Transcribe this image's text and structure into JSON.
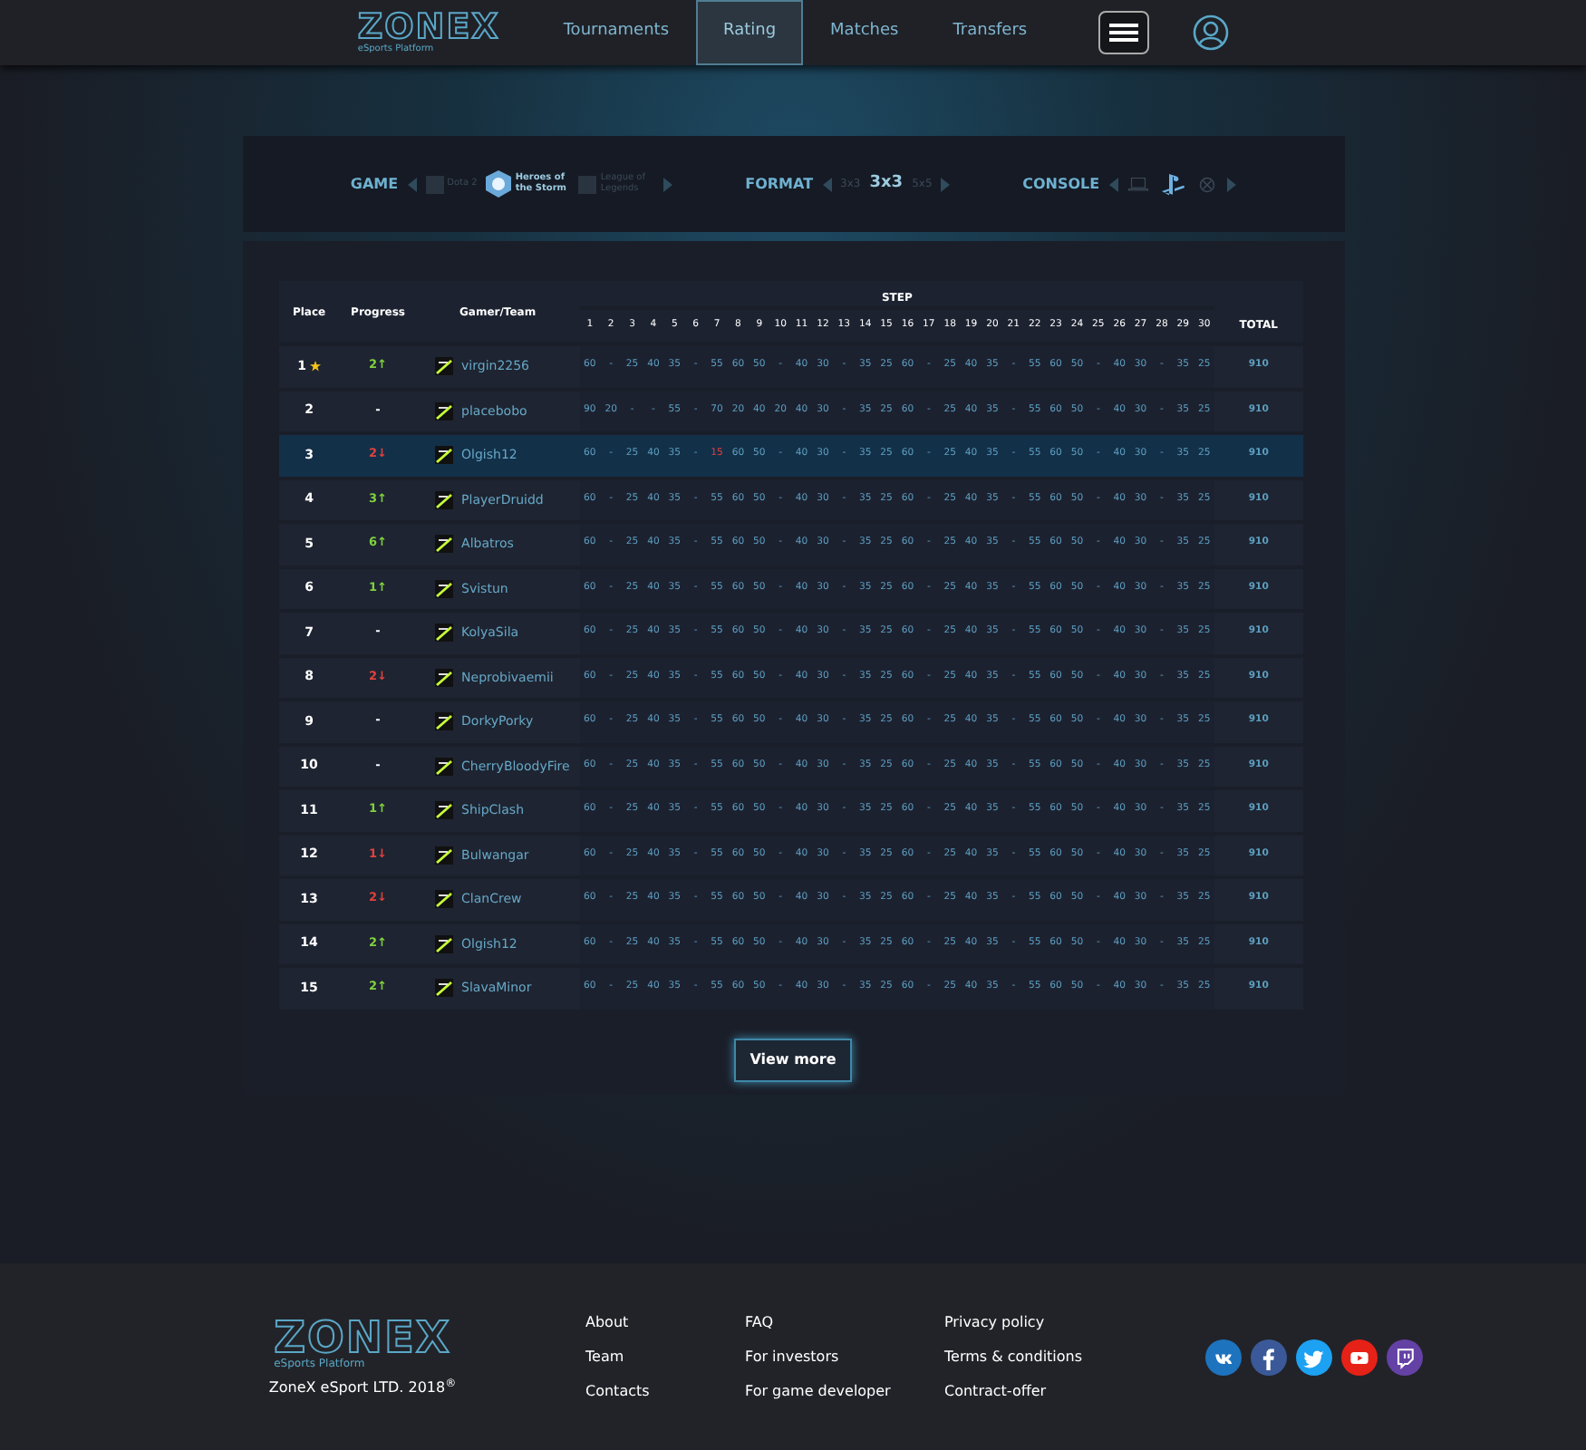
{
  "header": {
    "logo": "ZONEX",
    "logo_subtitle": "eSports Platform",
    "nav": [
      {
        "label": "Tournaments",
        "selected": false
      },
      {
        "label": "Rating",
        "selected": true
      },
      {
        "label": "Matches",
        "selected": false
      },
      {
        "label": "Transfers",
        "selected": false
      }
    ]
  },
  "filters": [
    {
      "label": "GAME",
      "kind": "game",
      "options": [
        {
          "label": "Dota 2",
          "selected": false
        },
        {
          "label": "Heroes of the Storm",
          "selected": true
        },
        {
          "label": "League of Legends",
          "selected": false
        }
      ]
    },
    {
      "label": "FORMAT",
      "kind": "format",
      "options": [
        {
          "label": "3x3",
          "selected": false
        },
        {
          "label": "3x3",
          "selected": true
        },
        {
          "label": "5x5",
          "selected": false
        }
      ]
    },
    {
      "label": "CONSOLE",
      "kind": "console",
      "options": [
        {
          "kind": "pc",
          "selected": false
        },
        {
          "kind": "playstation",
          "selected": true
        },
        {
          "kind": "xbox",
          "selected": false
        }
      ]
    }
  ],
  "table": {
    "columns": {
      "place": "Place",
      "progress": "Progress",
      "gamer": "Gamer/Team",
      "step_group": "STEP",
      "steps": [
        "1",
        "2",
        "3",
        "4",
        "5",
        "6",
        "7",
        "8",
        "9",
        "10",
        "11",
        "12",
        "13",
        "14",
        "15",
        "16",
        "17",
        "18",
        "19",
        "20",
        "21",
        "22",
        "23",
        "24",
        "25",
        "26",
        "27",
        "28",
        "29",
        "30"
      ],
      "total": "TOTAL"
    },
    "rows": [
      {
        "place": "1",
        "starred": true,
        "progress": "2↑",
        "kind": "up",
        "gamer": "virgin2256",
        "selected": false,
        "steps": [
          "60",
          "-",
          "25",
          "40",
          "35",
          "-",
          "55",
          "60",
          "50",
          "-",
          "40",
          "30",
          "-",
          "35",
          "25",
          "60",
          "-",
          "25",
          "40",
          "35",
          "-",
          "55",
          "60",
          "50",
          "-",
          "40",
          "30",
          "-",
          "35",
          "25"
        ],
        "total": "910"
      },
      {
        "place": "2",
        "starred": false,
        "progress": "-",
        "kind": "none",
        "gamer": "placebobo",
        "selected": false,
        "steps": [
          "90",
          "20",
          "-",
          "-",
          "55",
          "-",
          "70",
          "20",
          "40",
          "20",
          "40",
          "30",
          "-",
          "35",
          "25",
          "60",
          "-",
          "25",
          "40",
          "35",
          "-",
          "55",
          "60",
          "50",
          "-",
          "40",
          "30",
          "-",
          "35",
          "25"
        ],
        "total": "910"
      },
      {
        "place": "3",
        "starred": false,
        "progress": "2↓",
        "kind": "down",
        "gamer": "Olgish12",
        "selected": true,
        "steps": [
          "60",
          "-",
          "25",
          "40",
          "35",
          "-",
          {
            "value": "15",
            "alert": true
          },
          "60",
          "50",
          "-",
          "40",
          "30",
          "-",
          "35",
          "25",
          "60",
          "-",
          "25",
          "40",
          "35",
          "-",
          "55",
          "60",
          "50",
          "-",
          "40",
          "30",
          "-",
          "35",
          "25"
        ],
        "total": "910"
      },
      {
        "place": "4",
        "starred": false,
        "progress": "3↑",
        "kind": "up",
        "gamer": "PlayerDruidd",
        "selected": false,
        "steps": [
          "60",
          "-",
          "25",
          "40",
          "35",
          "-",
          "55",
          "60",
          "50",
          "-",
          "40",
          "30",
          "-",
          "35",
          "25",
          "60",
          "-",
          "25",
          "40",
          "35",
          "-",
          "55",
          "60",
          "50",
          "-",
          "40",
          "30",
          "-",
          "35",
          "25"
        ],
        "total": "910"
      },
      {
        "place": "5",
        "starred": false,
        "progress": "6↑",
        "kind": "up",
        "gamer": "Albatros",
        "selected": false,
        "steps": [
          "60",
          "-",
          "25",
          "40",
          "35",
          "-",
          "55",
          "60",
          "50",
          "-",
          "40",
          "30",
          "-",
          "35",
          "25",
          "60",
          "-",
          "25",
          "40",
          "35",
          "-",
          "55",
          "60",
          "50",
          "-",
          "40",
          "30",
          "-",
          "35",
          "25"
        ],
        "total": "910"
      },
      {
        "place": "6",
        "starred": false,
        "progress": "1↑",
        "kind": "up",
        "gamer": "Svistun",
        "selected": false,
        "steps": [
          "60",
          "-",
          "25",
          "40",
          "35",
          "-",
          "55",
          "60",
          "50",
          "-",
          "40",
          "30",
          "-",
          "35",
          "25",
          "60",
          "-",
          "25",
          "40",
          "35",
          "-",
          "55",
          "60",
          "50",
          "-",
          "40",
          "30",
          "-",
          "35",
          "25"
        ],
        "total": "910"
      },
      {
        "place": "7",
        "starred": false,
        "progress": "-",
        "kind": "none",
        "gamer": "KolyaSila",
        "selected": false,
        "steps": [
          "60",
          "-",
          "25",
          "40",
          "35",
          "-",
          "55",
          "60",
          "50",
          "-",
          "40",
          "30",
          "-",
          "35",
          "25",
          "60",
          "-",
          "25",
          "40",
          "35",
          "-",
          "55",
          "60",
          "50",
          "-",
          "40",
          "30",
          "-",
          "35",
          "25"
        ],
        "total": "910"
      },
      {
        "place": "8",
        "starred": false,
        "progress": "2↓",
        "kind": "down",
        "gamer": "Neprobivaemii",
        "selected": false,
        "steps": [
          "60",
          "-",
          "25",
          "40",
          "35",
          "-",
          "55",
          "60",
          "50",
          "-",
          "40",
          "30",
          "-",
          "35",
          "25",
          "60",
          "-",
          "25",
          "40",
          "35",
          "-",
          "55",
          "60",
          "50",
          "-",
          "40",
          "30",
          "-",
          "35",
          "25"
        ],
        "total": "910"
      },
      {
        "place": "9",
        "starred": false,
        "progress": "-",
        "kind": "none",
        "gamer": "DorkyPorky",
        "selected": false,
        "steps": [
          "60",
          "-",
          "25",
          "40",
          "35",
          "-",
          "55",
          "60",
          "50",
          "-",
          "40",
          "30",
          "-",
          "35",
          "25",
          "60",
          "-",
          "25",
          "40",
          "35",
          "-",
          "55",
          "60",
          "50",
          "-",
          "40",
          "30",
          "-",
          "35",
          "25"
        ],
        "total": "910"
      },
      {
        "place": "10",
        "starred": false,
        "progress": "-",
        "kind": "none",
        "gamer": "CherryBloodyFire",
        "selected": false,
        "steps": [
          "60",
          "-",
          "25",
          "40",
          "35",
          "-",
          "55",
          "60",
          "50",
          "-",
          "40",
          "30",
          "-",
          "35",
          "25",
          "60",
          "-",
          "25",
          "40",
          "35",
          "-",
          "55",
          "60",
          "50",
          "-",
          "40",
          "30",
          "-",
          "35",
          "25"
        ],
        "total": "910"
      },
      {
        "place": "11",
        "starred": false,
        "progress": "1↑",
        "kind": "up",
        "gamer": "ShipClash",
        "selected": false,
        "steps": [
          "60",
          "-",
          "25",
          "40",
          "35",
          "-",
          "55",
          "60",
          "50",
          "-",
          "40",
          "30",
          "-",
          "35",
          "25",
          "60",
          "-",
          "25",
          "40",
          "35",
          "-",
          "55",
          "60",
          "50",
          "-",
          "40",
          "30",
          "-",
          "35",
          "25"
        ],
        "total": "910"
      },
      {
        "place": "12",
        "starred": false,
        "progress": "1↓",
        "kind": "down",
        "gamer": "Bulwangar",
        "selected": false,
        "steps": [
          "60",
          "-",
          "25",
          "40",
          "35",
          "-",
          "55",
          "60",
          "50",
          "-",
          "40",
          "30",
          "-",
          "35",
          "25",
          "60",
          "-",
          "25",
          "40",
          "35",
          "-",
          "55",
          "60",
          "50",
          "-",
          "40",
          "30",
          "-",
          "35",
          "25"
        ],
        "total": "910"
      },
      {
        "place": "13",
        "starred": false,
        "progress": "2↓",
        "kind": "down",
        "gamer": "ClanCrew",
        "selected": false,
        "steps": [
          "60",
          "-",
          "25",
          "40",
          "35",
          "-",
          "55",
          "60",
          "50",
          "-",
          "40",
          "30",
          "-",
          "35",
          "25",
          "60",
          "-",
          "25",
          "40",
          "35",
          "-",
          "55",
          "60",
          "50",
          "-",
          "40",
          "30",
          "-",
          "35",
          "25"
        ],
        "total": "910"
      },
      {
        "place": "14",
        "starred": false,
        "progress": "2↑",
        "kind": "up",
        "gamer": "Olgish12",
        "selected": false,
        "steps": [
          "60",
          "-",
          "25",
          "40",
          "35",
          "-",
          "55",
          "60",
          "50",
          "-",
          "40",
          "30",
          "-",
          "35",
          "25",
          "60",
          "-",
          "25",
          "40",
          "35",
          "-",
          "55",
          "60",
          "50",
          "-",
          "40",
          "30",
          "-",
          "35",
          "25"
        ],
        "total": "910"
      },
      {
        "place": "15",
        "starred": false,
        "progress": "2↑",
        "kind": "up",
        "gamer": "SlavaMinor",
        "selected": false,
        "steps": [
          "60",
          "-",
          "25",
          "40",
          "35",
          "-",
          "55",
          "60",
          "50",
          "-",
          "40",
          "30",
          "-",
          "35",
          "25",
          "60",
          "-",
          "25",
          "40",
          "35",
          "-",
          "55",
          "60",
          "50",
          "-",
          "40",
          "30",
          "-",
          "35",
          "25"
        ],
        "total": "910"
      }
    ]
  },
  "view_more": "View more",
  "footer": {
    "logo": "ZONEX",
    "logo_subtitle": "eSports Platform",
    "copyright": "ZoneX eSport LTD. 2018$^{®}$",
    "link_columns": [
      [
        "About",
        "Team",
        "Contacts"
      ],
      [
        "FAQ",
        "For investors",
        "For game developer"
      ],
      [
        "Privacy policy",
        "Terms & conditions",
        "Contract-offer"
      ]
    ],
    "social": [
      {
        "kind": "vk",
        "color": "#1e73be"
      },
      {
        "kind": "facebook",
        "color": "#3b5998"
      },
      {
        "kind": "twitter",
        "color": "#1da1f2"
      },
      {
        "kind": "youtube",
        "color": "#e62117"
      },
      {
        "kind": "twitch",
        "color": "#6441a5"
      }
    ]
  }
}
